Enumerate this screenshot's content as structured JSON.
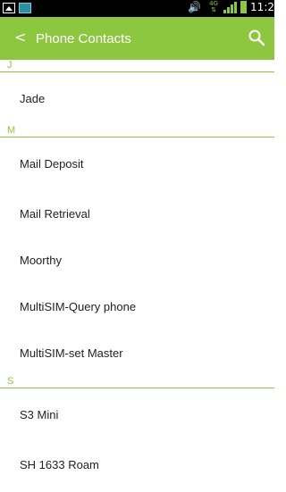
{
  "status_bar": {
    "time": "11:2",
    "network_type": "4G",
    "icons": [
      "image-icon",
      "app-icon",
      "volume-icon",
      "data-icon",
      "signal-icon",
      "battery-icon"
    ]
  },
  "action_bar": {
    "back_symbol": "<",
    "title": "Phone Contacts",
    "search_icon": "search-icon",
    "color": "#8dc63f"
  },
  "sections": [
    {
      "letter": "J",
      "contacts": [
        "Jade"
      ]
    },
    {
      "letter": "M",
      "contacts": [
        "Mail Deposit",
        "Mail Retrieval",
        "Moorthy",
        "MultiSIM-Query phone",
        "MultiSIM-set Master"
      ]
    },
    {
      "letter": "S",
      "contacts": [
        "S3 Mini",
        "SH 1633 Roam"
      ]
    }
  ]
}
